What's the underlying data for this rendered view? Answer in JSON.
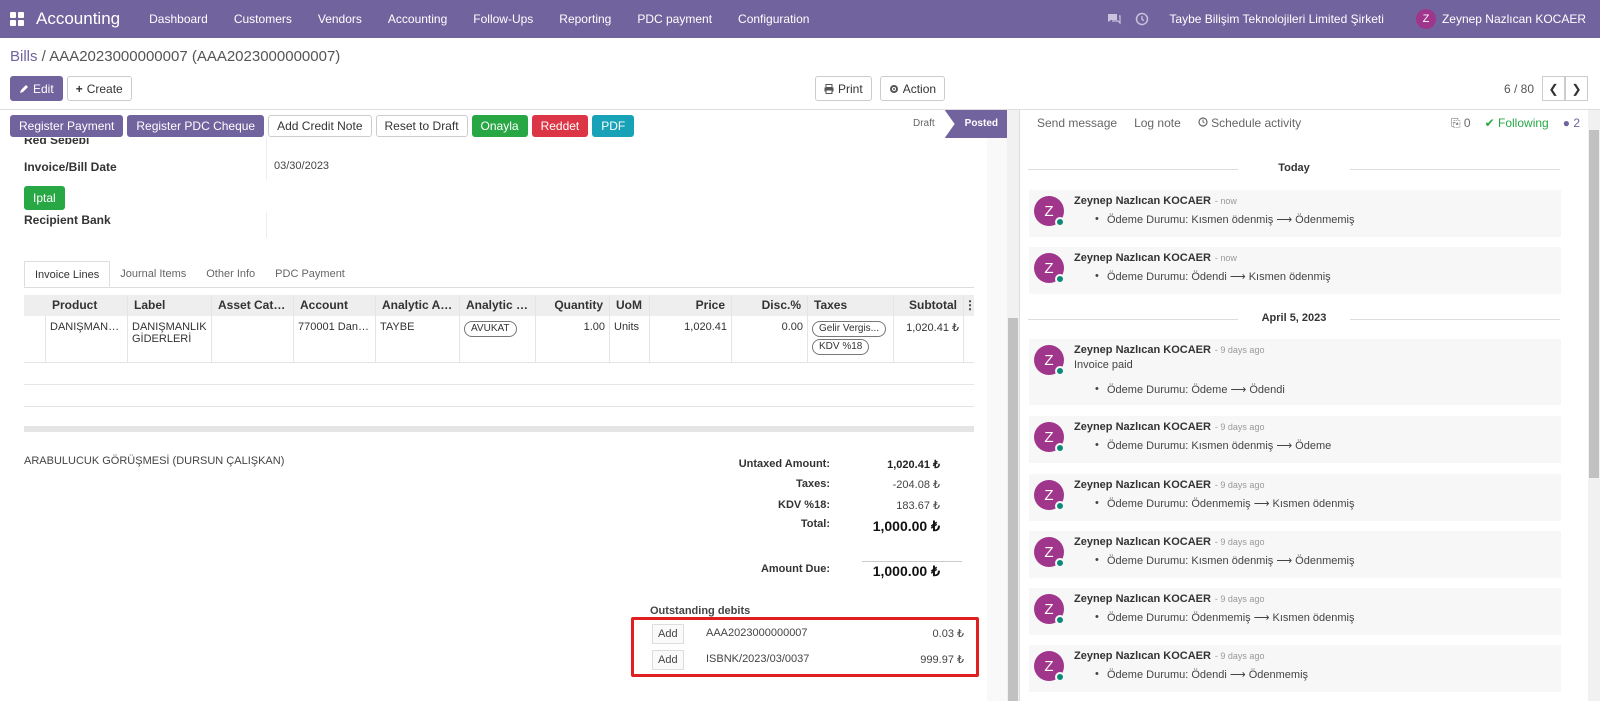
{
  "nav": {
    "app_name": "Accounting",
    "menu": [
      "Dashboard",
      "Customers",
      "Vendors",
      "Accounting",
      "Follow-Ups",
      "Reporting",
      "PDC payment",
      "Configuration"
    ],
    "company": "Taybe Bilişim Teknolojileri Limited Şirketi",
    "user_initial": "Z",
    "user_name": "Zeynep Nazlıcan KOCAER"
  },
  "breadcrumb": {
    "parent": "Bills",
    "separator": " / ",
    "current": "AAA2023000000007 (AAA2023000000007)"
  },
  "control_panel": {
    "edit": "Edit",
    "create": "Create",
    "print": "Print",
    "action": "Action",
    "pager_value": "6 / 80"
  },
  "statusbar": {
    "buttons": [
      "Register Payment",
      "Register PDC Cheque",
      "Add Credit Note",
      "Reset to Draft",
      "Onayla",
      "Reddet",
      "PDF"
    ],
    "stages": [
      "Draft",
      "Posted"
    ],
    "active_stage": "Posted"
  },
  "form": {
    "red_sebebi_label": "Red Sebebi",
    "invoice_date_label": "Invoice/Bill Date",
    "invoice_date_value": "03/30/2023",
    "iptal_button": "Iptal",
    "recipient_bank_label": "Recipient Bank",
    "tabs": [
      "Invoice Lines",
      "Journal Items",
      "Other Info",
      "PDC Payment"
    ],
    "active_tab": "Invoice Lines",
    "columns": [
      "Product",
      "Label",
      "Asset Categ...",
      "Account",
      "Analytic Acc...",
      "Analytic Tags",
      "Quantity",
      "UoM",
      "Price",
      "Disc.%",
      "Taxes",
      "Subtotal"
    ],
    "lines": [
      {
        "product": "DANIŞMANLI...",
        "label": "DANIŞMANLIK GİDERLERİ",
        "asset": "",
        "account": "770001 Danış...",
        "analytic_account": "TAYBE",
        "analytic_tag": "AVUKAT",
        "quantity": "1.00",
        "uom": "Units",
        "price": "1,020.41",
        "discount": "0.00",
        "taxes": [
          "Gelir Vergis...",
          "KDV %18"
        ],
        "subtotal": "1,020.41 ₺"
      }
    ],
    "narration": "ARABULUCUK GÖRÜŞMESİ (DURSUN ÇALIŞKAN)",
    "totals": {
      "untaxed_label": "Untaxed Amount:",
      "untaxed_value": "1,020.41 ₺",
      "taxes_label": "Taxes:",
      "taxes_value": "-204.08 ₺",
      "kdv_label": "KDV %18:",
      "kdv_value": "183.67 ₺",
      "total_label": "Total:",
      "total_value": "1,000.00 ₺",
      "due_label": "Amount Due:",
      "due_value": "1,000.00 ₺"
    },
    "outstanding_title": "Outstanding debits",
    "outstanding": [
      {
        "add": "Add",
        "ref": "AAA2023000000007",
        "amount": "0.03 ₺"
      },
      {
        "add": "Add",
        "ref": "ISBNK/2023/03/0037",
        "amount": "999.97 ₺"
      }
    ]
  },
  "chatter": {
    "send_message": "Send message",
    "log_note": "Log note",
    "schedule_activity": "Schedule activity",
    "attachments": "0",
    "following": "Following",
    "followers": "2",
    "today_label": "Today",
    "april_label": "April 5, 2023",
    "messages": [
      {
        "initial": "Z",
        "author": "Zeynep Nazlıcan KOCAER",
        "time": "- now",
        "body": "",
        "change": "Ödeme Durumu: Kısmen ödenmiş ⟶ Ödenmemiş"
      },
      {
        "initial": "Z",
        "author": "Zeynep Nazlıcan KOCAER",
        "time": "- now",
        "body": "",
        "change": "Ödeme Durumu: Ödendi ⟶ Kısmen ödenmiş"
      },
      {
        "initial": "Z",
        "author": "Zeynep Nazlıcan KOCAER",
        "time": "- 9 days ago",
        "body": "Invoice paid",
        "change": "Ödeme Durumu: Ödeme ⟶ Ödendi"
      },
      {
        "initial": "Z",
        "author": "Zeynep Nazlıcan KOCAER",
        "time": "- 9 days ago",
        "body": "",
        "change": "Ödeme Durumu: Kısmen ödenmiş ⟶ Ödeme"
      },
      {
        "initial": "Z",
        "author": "Zeynep Nazlıcan KOCAER",
        "time": "- 9 days ago",
        "body": "",
        "change": "Ödeme Durumu: Ödenmemiş ⟶ Kısmen ödenmiş"
      },
      {
        "initial": "Z",
        "author": "Zeynep Nazlıcan KOCAER",
        "time": "- 9 days ago",
        "body": "",
        "change": "Ödeme Durumu: Kısmen ödenmiş ⟶ Ödenmemiş"
      },
      {
        "initial": "Z",
        "author": "Zeynep Nazlıcan KOCAER",
        "time": "- 9 days ago",
        "body": "",
        "change": "Ödeme Durumu: Ödenmemiş ⟶ Kısmen ödenmiş"
      },
      {
        "initial": "Z",
        "author": "Zeynep Nazlıcan KOCAER",
        "time": "- 9 days ago",
        "body": "",
        "change": "Ödeme Durumu: Ödendi ⟶ Ödenmemiş"
      }
    ]
  },
  "colors": {
    "brand": "#71639e",
    "success": "#28a745",
    "danger": "#dc3545",
    "info": "#17a2b8",
    "highlight": "#e02020"
  }
}
